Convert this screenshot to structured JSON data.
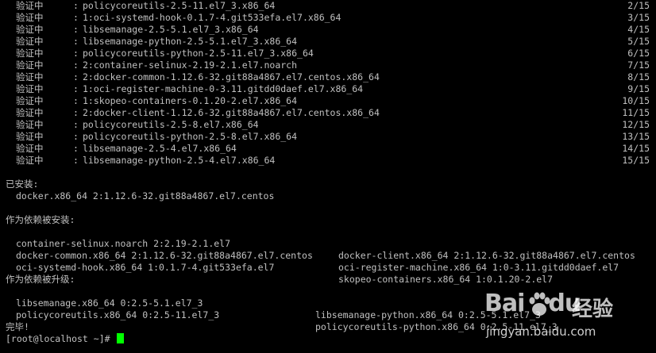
{
  "verify_lines": [
    {
      "label": "验证中",
      "package": "policycoreutils-2.5-11.el7_3.x86_64",
      "count": "2/15"
    },
    {
      "label": "验证中",
      "package": "1:oci-systemd-hook-0.1.7-4.git533efa.el7.x86_64",
      "count": "3/15"
    },
    {
      "label": "验证中",
      "package": "libsemanage-2.5-5.1.el7_3.x86_64",
      "count": "4/15"
    },
    {
      "label": "验证中",
      "package": "libsemanage-python-2.5-5.1.el7_3.x86_64",
      "count": "5/15"
    },
    {
      "label": "验证中",
      "package": "policycoreutils-python-2.5-11.el7_3.x86_64",
      "count": "6/15"
    },
    {
      "label": "验证中",
      "package": "2:container-selinux-2.19-2.1.el7.noarch",
      "count": "7/15"
    },
    {
      "label": "验证中",
      "package": "2:docker-common-1.12.6-32.git88a4867.el7.centos.x86_64",
      "count": "8/15"
    },
    {
      "label": "验证中",
      "package": "1:oci-register-machine-0-3.11.gitdd0daef.el7.x86_64",
      "count": "9/15"
    },
    {
      "label": "验证中",
      "package": "1:skopeo-containers-0.1.20-2.el7.x86_64",
      "count": "10/15"
    },
    {
      "label": "验证中",
      "package": "2:docker-client-1.12.6-32.git88a4867.el7.centos.x86_64",
      "count": "11/15"
    },
    {
      "label": "验证中",
      "package": "policycoreutils-2.5-8.el7.x86_64",
      "count": "12/15"
    },
    {
      "label": "验证中",
      "package": "policycoreutils-python-2.5-8.el7.x86_64",
      "count": "13/15"
    },
    {
      "label": "验证中",
      "package": "libsemanage-2.5-4.el7.x86_64",
      "count": "14/15"
    },
    {
      "label": "验证中",
      "package": "libsemanage-python-2.5-4.el7.x86_64",
      "count": "15/15"
    }
  ],
  "colon": ":",
  "installed": {
    "heading": "已安装:",
    "packages": [
      "docker.x86_64 2:1.12.6-32.git88a4867.el7.centos"
    ]
  },
  "dependency_installed": {
    "heading": "作为依赖被安装:",
    "rows": [
      [
        "container-selinux.noarch 2:2.19-2.1.el7",
        "docker-client.x86_64 2:1.12.6-32.git88a4867.el7.centos"
      ],
      [
        "docker-common.x86_64 2:1.12.6-32.git88a4867.el7.centos",
        "oci-register-machine.x86_64 1:0-3.11.gitdd0daef.el7"
      ],
      [
        "oci-systemd-hook.x86_64 1:0.1.7-4.git533efa.el7",
        "skopeo-containers.x86_64 1:0.1.20-2.el7"
      ]
    ]
  },
  "dependency_upgraded": {
    "heading": "作为依赖被升级:",
    "rows": [
      [
        "libsemanage.x86_64 0:2.5-5.1.el7_3",
        "libsemanage-python.x86_64 0:2.5-5.1.el7_3"
      ],
      [
        "policycoreutils.x86_64 0:2.5-11.el7_3",
        "policycoreutils-python.x86_64 0:2.5-11.el7_3"
      ]
    ]
  },
  "complete": "完毕!",
  "prompt": "[root@localhost ~]# ",
  "watermark": {
    "logo": "Bai",
    "logo_suffix": "du",
    "brand": "经验",
    "url": "jingyan.baidu.com"
  },
  "colors": {
    "background": "#000000",
    "text": "#c0c0c0",
    "cursor": "#00ff00"
  }
}
